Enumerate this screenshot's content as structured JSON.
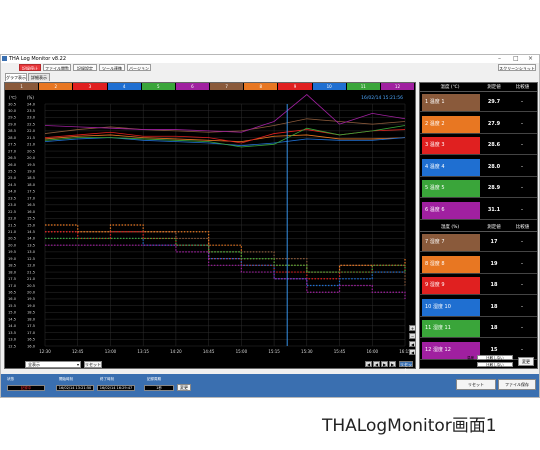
{
  "app": {
    "title": "THA Log Monitor v8.22",
    "window_controls": [
      "–",
      "□",
      "×"
    ]
  },
  "toolbar": {
    "buttons": [
      "記録停止",
      "ファイル閲覧",
      "記録設定",
      "ツール連携",
      "バージョン"
    ],
    "right_button": "スクリーンショット"
  },
  "tabs": [
    "グラフ表示",
    "詳細表示"
  ],
  "channels": {
    "labels": [
      "1",
      "2",
      "3",
      "4",
      "5",
      "6",
      "7",
      "8",
      "9",
      "10",
      "11",
      "12"
    ],
    "colors": [
      "#8a5a3b",
      "#e87722",
      "#e02020",
      "#1f6fd1",
      "#3aa53a",
      "#a020a0",
      "#8a5a3b",
      "#e87722",
      "#e02020",
      "#1f6fd1",
      "#3aa53a",
      "#a020a0"
    ]
  },
  "chart": {
    "timestamp": "16/02/14 15:21:56",
    "left_unit": "(℃)",
    "right_unit": "(%)",
    "left_ticks": [
      "30.5",
      "30.0",
      "29.5",
      "29.0",
      "28.5",
      "28.0",
      "27.5",
      "27.0",
      "26.5",
      "26.0",
      "25.5",
      "25.0",
      "24.5",
      "24.0",
      "23.5",
      "23.0",
      "22.5",
      "22.0",
      "21.5",
      "21.0",
      "20.5",
      "20.0",
      "19.5",
      "19.0",
      "18.5",
      "18.0",
      "17.5",
      "17.0",
      "16.5",
      "16.0",
      "15.5",
      "15.0",
      "14.5",
      "14.0",
      "13.5",
      "13.0",
      "12.5"
    ],
    "right_ticks": [
      "24.0",
      "23.5",
      "23.0",
      "22.5",
      "22.0",
      "21.5",
      "21.0",
      "20.5",
      "20.0",
      "19.5",
      "19.0",
      "18.5",
      "18.0",
      "17.5",
      "17.0",
      "16.5",
      "16.0",
      "15.5",
      "15.0",
      "14.5",
      "14.0",
      "13.5",
      "13.0",
      "12.5",
      "12.0",
      "21.5",
      "21.0",
      "20.5",
      "20.0",
      "19.5",
      "19.0",
      "18.5",
      "18.0",
      "17.5",
      "17.0",
      "16.5",
      "16.0"
    ],
    "x_ticks": [
      "12:30",
      "12:45",
      "13:00",
      "13:15",
      "14:20",
      "14:45",
      "15:00",
      "15:15",
      "15:30",
      "15:45",
      "16:00",
      "16:15"
    ],
    "nav_buttons": [
      "+",
      "−",
      "◀",
      "◀",
      "▶",
      "▶"
    ]
  },
  "chart_data": {
    "type": "line",
    "x": [
      "12:30",
      "12:45",
      "13:00",
      "13:15",
      "14:20",
      "14:45",
      "15:00",
      "15:15",
      "15:30",
      "15:45",
      "16:00",
      "16:15"
    ],
    "series": [
      {
        "name": "1 温度 1",
        "values": [
          28.3,
          28.6,
          28.8,
          28.6,
          28.5,
          28.4,
          28.5,
          28.9,
          29.4,
          29.2,
          29.0,
          29.2
        ]
      },
      {
        "name": "2 温度 2",
        "values": [
          27.9,
          28.1,
          28.2,
          28.0,
          27.9,
          27.8,
          27.7,
          28.1,
          28.2,
          27.9,
          27.9,
          28.0
        ]
      },
      {
        "name": "3 温度 3",
        "values": [
          28.0,
          28.2,
          28.4,
          28.1,
          28.1,
          28.0,
          27.6,
          28.3,
          28.6,
          28.2,
          28.5,
          28.6
        ]
      },
      {
        "name": "4 温度 4",
        "values": [
          27.7,
          27.9,
          28.0,
          27.8,
          27.7,
          27.6,
          27.4,
          27.6,
          27.9,
          27.8,
          27.8,
          28.0
        ]
      },
      {
        "name": "5 温度 5",
        "values": [
          27.8,
          28.0,
          28.0,
          27.9,
          27.8,
          27.7,
          27.3,
          27.5,
          28.7,
          28.2,
          28.5,
          28.9
        ]
      },
      {
        "name": "6 温度 6",
        "values": [
          28.9,
          28.8,
          28.7,
          28.6,
          28.6,
          28.5,
          28.4,
          29.2,
          31.2,
          29.0,
          29.8,
          29.4
        ]
      }
    ],
    "step_series": [
      {
        "name": "7 湿度 7",
        "values": [
          21.0,
          21.0,
          21.0,
          21.0,
          20.5,
          19.5,
          19.5,
          19.0,
          18.0,
          18.5,
          18.0,
          17.0
        ]
      },
      {
        "name": "8 湿度 8",
        "values": [
          21.5,
          21.0,
          21.5,
          21.0,
          21.0,
          20.0,
          19.0,
          18.5,
          18.0,
          18.5,
          18.5,
          19.0
        ]
      },
      {
        "name": "9 湿度 9",
        "values": [
          21.0,
          20.5,
          21.0,
          20.5,
          20.0,
          19.0,
          18.5,
          18.0,
          17.5,
          18.0,
          18.5,
          18.0
        ]
      },
      {
        "name": "10 湿度 10",
        "values": [
          20.5,
          20.5,
          20.5,
          20.0,
          20.0,
          19.0,
          18.5,
          17.5,
          17.0,
          17.5,
          18.0,
          18.0
        ]
      },
      {
        "name": "11 湿度 11",
        "values": [
          20.5,
          20.5,
          20.5,
          20.5,
          20.0,
          19.5,
          19.0,
          18.5,
          18.0,
          18.0,
          18.5,
          18.0
        ]
      },
      {
        "name": "12 湿度 12",
        "values": [
          20.0,
          20.0,
          20.0,
          20.0,
          19.5,
          18.5,
          18.0,
          17.5,
          16.5,
          17.0,
          16.5,
          16.0
        ]
      }
    ],
    "ylim": [
      12.5,
      30.5
    ],
    "grid": true,
    "cursor_x": "15:21"
  },
  "temp_panel": {
    "headers": [
      "温度 (℃)",
      "測定値",
      "比較値"
    ],
    "rows": [
      {
        "label": "1 温度 1",
        "value": "29.7",
        "compare": "–",
        "color": "#8a5a3b"
      },
      {
        "label": "2 温度 2",
        "value": "27.9",
        "compare": "–",
        "color": "#e87722"
      },
      {
        "label": "3 温度 3",
        "value": "28.6",
        "compare": "–",
        "color": "#e02020"
      },
      {
        "label": "4 温度 4",
        "value": "28.0",
        "compare": "–",
        "color": "#1f6fd1"
      },
      {
        "label": "5 温度 5",
        "value": "28.9",
        "compare": "–",
        "color": "#3aa53a"
      },
      {
        "label": "6 温度 6",
        "value": "31.1",
        "compare": "–",
        "color": "#a020a0"
      }
    ]
  },
  "humid_panel": {
    "headers": [
      "湿度 (%)",
      "測定値",
      "比較値"
    ],
    "rows": [
      {
        "label": "7 湿度 7",
        "value": "17",
        "compare": "–",
        "color": "#8a5a3b"
      },
      {
        "label": "8 湿度 8",
        "value": "19",
        "compare": "–",
        "color": "#e87722"
      },
      {
        "label": "9 湿度 9",
        "value": "18",
        "compare": "–",
        "color": "#e02020"
      },
      {
        "label": "10 湿度 10",
        "value": "18",
        "compare": "–",
        "color": "#1f6fd1"
      },
      {
        "label": "11 湿度 11",
        "value": "18",
        "compare": "–",
        "color": "#3aa53a"
      },
      {
        "label": "12 湿度 12",
        "value": "15",
        "compare": "–",
        "color": "#a020a0"
      }
    ]
  },
  "display_controls": {
    "label": "表示範囲",
    "select_value": "全表示",
    "reset_label": "リセット"
  },
  "compare_controls": {
    "label": "比較対象値",
    "temp_label": "温度",
    "temp_value": "比較しない",
    "humid_label": "湿度",
    "humid_value": "比較しない",
    "change_label": "変更"
  },
  "status": {
    "state_label": "状態",
    "state_value": "記録中",
    "start_label": "開始時刻",
    "start_value": "16/02/14 13:21:50",
    "end_label": "終了時刻",
    "end_value": "16/02/14 16:29:47",
    "interval_label": "記録周期",
    "interval_value": "1秒",
    "interval_change": "変更",
    "reset_button": "リセット",
    "save_button": "ファイル保存"
  },
  "caption": "THALogMonitor画面1"
}
